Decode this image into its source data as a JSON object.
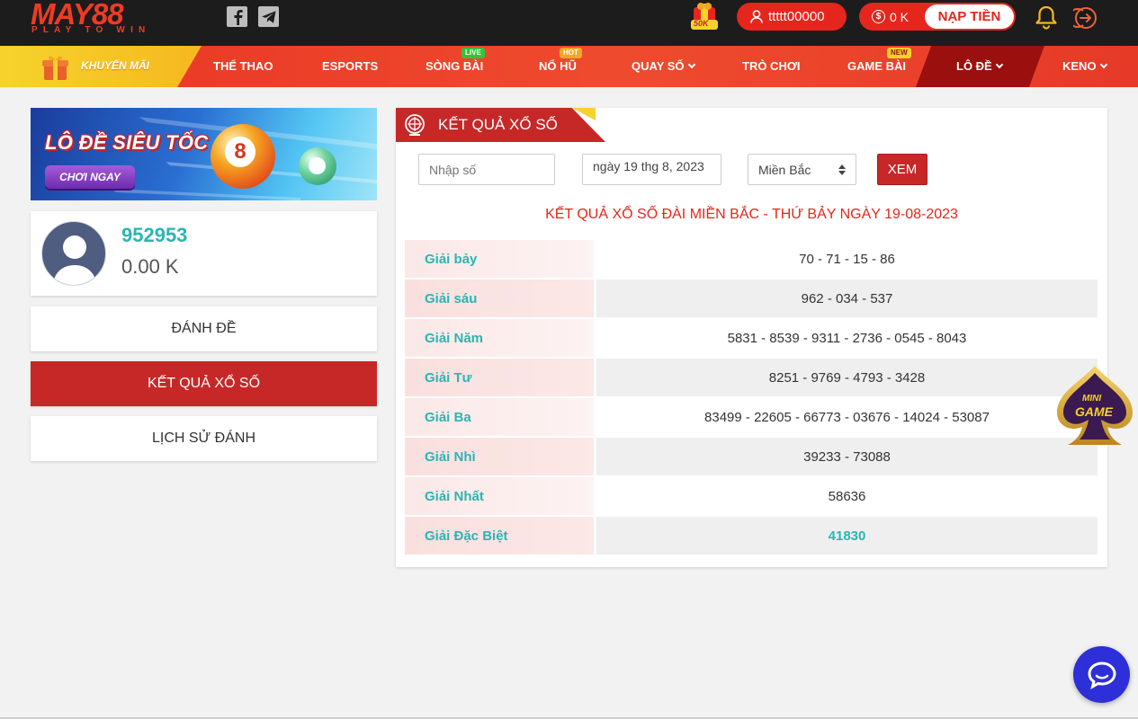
{
  "header": {
    "logo_text": "MAY88",
    "logo_tagline": "PLAY TO WIN",
    "promo_badge": "50K",
    "username": "ttttt00000",
    "balance": "0 K",
    "deposit_label": "NẠP TIỀN"
  },
  "nav": {
    "promo": "KHUYẾN MÃI",
    "items": [
      {
        "label": "THỂ THAO",
        "badge": ""
      },
      {
        "label": "ESPORTS",
        "badge": ""
      },
      {
        "label": "SÒNG BÀI",
        "badge": "LIVE"
      },
      {
        "label": "NỔ HŨ",
        "badge": "HOT"
      },
      {
        "label": "QUAY SỐ",
        "badge": ""
      },
      {
        "label": "TRÒ CHƠI",
        "badge": ""
      },
      {
        "label": "GAME BÀI",
        "badge": "NEW"
      },
      {
        "label": "LÔ ĐỀ",
        "badge": ""
      },
      {
        "label": "KENO",
        "badge": ""
      }
    ]
  },
  "banner": {
    "title": "LÔ ĐỀ SIÊU TỐC",
    "button": "CHƠI NGAY",
    "ball_number": "8"
  },
  "profile": {
    "id": "952953",
    "balance": "0.00 K"
  },
  "sidebar": {
    "items": [
      {
        "label": "ĐÁNH ĐỀ"
      },
      {
        "label": "KẾT QUẢ XỔ SỐ"
      },
      {
        "label": "LỊCH SỬ ĐÁNH"
      }
    ]
  },
  "results": {
    "panel_title": "KẾT QUẢ XỔ SỐ",
    "search_placeholder": "Nhập số",
    "date_value": "ngày 19 thg 8, 2023",
    "region_value": "Miền Bắc",
    "view_button": "XEM",
    "heading": "KẾT QUẢ XỔ SỐ ĐÀI MIỀN BẮC - THỨ BẢY NGÀY 19-08-2023",
    "rows": [
      {
        "prize": "Giải bảy",
        "numbers": "70 - 71 - 15 - 86"
      },
      {
        "prize": "Giải sáu",
        "numbers": "962 - 034 - 537"
      },
      {
        "prize": "Giải Năm",
        "numbers": "5831 - 8539 - 9311 - 2736 - 0545 - 8043"
      },
      {
        "prize": "Giải Tư",
        "numbers": "8251 - 9769 - 4793 - 3428"
      },
      {
        "prize": "Giải Ba",
        "numbers": "83499 - 22605 - 66773 - 03676 - 14024 - 53087"
      },
      {
        "prize": "Giải Nhì",
        "numbers": "39233 - 73088"
      },
      {
        "prize": "Giải Nhất",
        "numbers": "58636"
      },
      {
        "prize": "Giải Đặc Biệt",
        "numbers": "41830"
      }
    ]
  },
  "minigame": {
    "line1": "MINI",
    "line2": "GAME"
  },
  "colors": {
    "brand_red": "#c62828",
    "accent_teal": "#2bb5b3",
    "nav_yellow": "#f6d32c",
    "header_bg": "#1c1c1c"
  }
}
